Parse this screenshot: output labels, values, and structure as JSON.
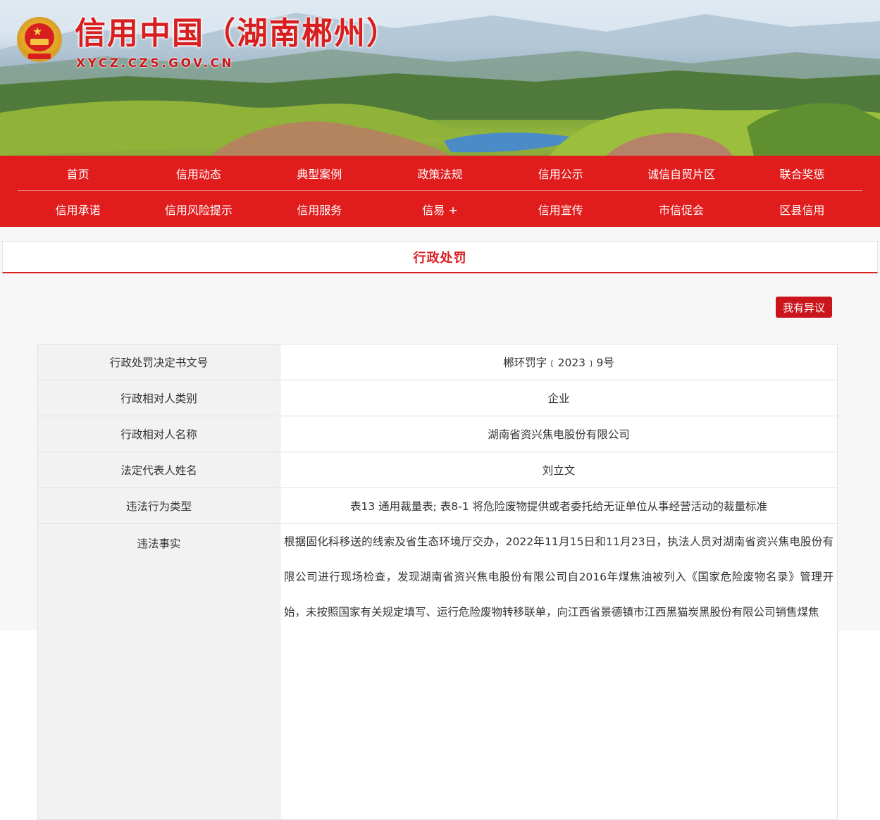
{
  "site": {
    "title": "信用中国（湖南郴州）",
    "url": "XYCZ.CZS.GOV.CN",
    "emblem_icon": "national-emblem-icon"
  },
  "nav": {
    "row1": [
      "首页",
      "信用动态",
      "典型案例",
      "政策法规",
      "信用公示",
      "诚信自贸片区",
      "联合奖惩"
    ],
    "row2": [
      "信用承诺",
      "信用风险提示",
      "信用服务",
      "信易 +",
      "信用宣传",
      "市信促会",
      "区县信用"
    ]
  },
  "section": {
    "title": "行政处罚",
    "objection_button": "我有异议"
  },
  "table": {
    "rows": [
      {
        "label": "行政处罚决定书文号",
        "value": "郴环罚字﹝2023﹞9号"
      },
      {
        "label": "行政相对人类别",
        "value": "企业"
      },
      {
        "label": "行政相对人名称",
        "value": "湖南省资兴焦电股份有限公司"
      },
      {
        "label": "法定代表人姓名",
        "value": "刘立文"
      },
      {
        "label": "违法行为类型",
        "value": "表13 通用裁量表; 表8-1 将危险废物提供或者委托给无证单位从事经营活动的裁量标准"
      },
      {
        "label": "违法事实",
        "value": "根据固化科移送的线索及省生态环境厅交办，2022年11月15日和11月23日，执法人员对湖南省资兴焦电股份有限公司进行现场检查，发现湖南省资兴焦电股份有限公司自2016年煤焦油被列入《国家危险废物名录》管理开始，未按照国家有关规定填写、运行危险废物转移联单，向江西省景德镇市江西黑猫炭黑股份有限公司销售煤焦"
      }
    ]
  },
  "colors": {
    "brand_red": "#e11c1c",
    "title_red": "#d81e1e",
    "button_red": "#c9151b"
  }
}
